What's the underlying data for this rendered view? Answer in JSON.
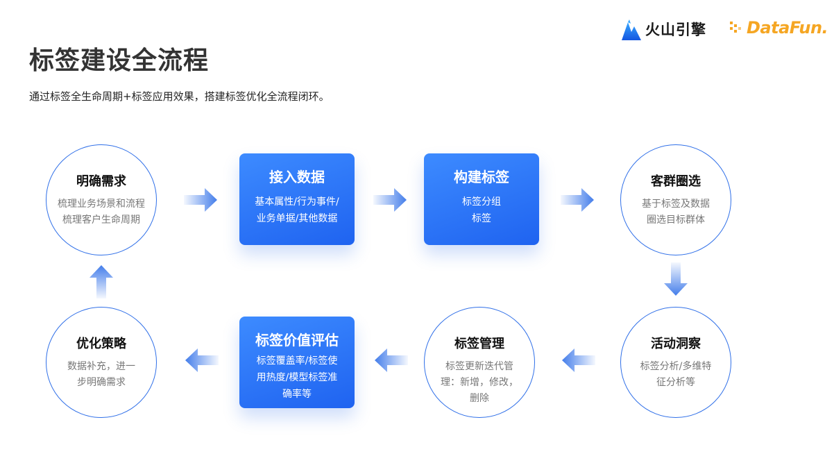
{
  "header": {
    "title": "标签建设全流程",
    "subtitle": "通过标签全生命周期+标签应用效果，搭建标签优化全流程闭环。"
  },
  "logos": {
    "volcano_text": "火山引擎",
    "datafun_text": "DataFun."
  },
  "colors": {
    "accent": "#2f6fe8",
    "box_gradient_start": "#3d8bff",
    "box_gradient_end": "#1f63f0",
    "datafun_orange": "#f5a623"
  },
  "nodes": {
    "define_needs": {
      "title": "明确需求",
      "desc": "梳理业务场景和流程\n梳理客户生命周期"
    },
    "ingest_data": {
      "title": "接入数据",
      "desc": "基本属性/行为事件/\n业务单据/其他数据"
    },
    "build_tags": {
      "title": "构建标签",
      "desc": "标签分组\n标签"
    },
    "segment_select": {
      "title": "客群圈选",
      "desc": "基于标签及数据\n圈选目标群体"
    },
    "activity_insight": {
      "title": "活动洞察",
      "desc": "标签分析/多维特\n征分析等"
    },
    "tag_management": {
      "title": "标签管理",
      "desc": "标签更新迭代管\n理：新增，修改，\n删除"
    },
    "tag_value_eval": {
      "title": "标签价值评估",
      "desc": "标签覆盖率/标签使\n用热度/模型标签准\n确率等"
    },
    "optimize_strategy": {
      "title": "优化策略",
      "desc": "数据补充，进一\n步明确需求"
    }
  },
  "arrows": [
    {
      "from": "define_needs",
      "to": "ingest_data",
      "direction": "right"
    },
    {
      "from": "ingest_data",
      "to": "build_tags",
      "direction": "right"
    },
    {
      "from": "build_tags",
      "to": "segment_select",
      "direction": "right"
    },
    {
      "from": "segment_select",
      "to": "activity_insight",
      "direction": "down"
    },
    {
      "from": "activity_insight",
      "to": "tag_management",
      "direction": "left"
    },
    {
      "from": "tag_management",
      "to": "tag_value_eval",
      "direction": "left"
    },
    {
      "from": "tag_value_eval",
      "to": "optimize_strategy",
      "direction": "left"
    },
    {
      "from": "optimize_strategy",
      "to": "define_needs",
      "direction": "up"
    }
  ]
}
